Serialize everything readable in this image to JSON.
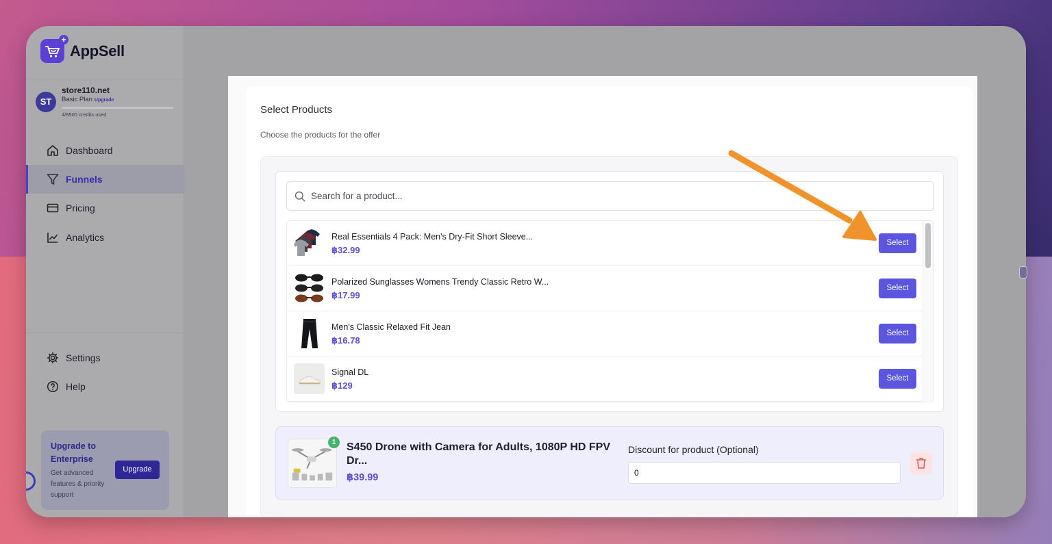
{
  "app": {
    "name": "AppSell"
  },
  "store": {
    "initials": "ST",
    "name": "store110.net",
    "plan": "Basic Plan",
    "upgrade_link": "Upgrade",
    "credits": "4/8500 credits used",
    "credits_fraction": 0.0005
  },
  "sidebar": {
    "items": [
      {
        "label": "Dashboard",
        "icon": "home-icon",
        "active": false
      },
      {
        "label": "Funnels",
        "icon": "filter-icon",
        "active": true
      },
      {
        "label": "Pricing",
        "icon": "credit-card-icon",
        "active": false
      },
      {
        "label": "Analytics",
        "icon": "line-chart-icon",
        "active": false
      }
    ],
    "bottom_items": [
      {
        "label": "Settings",
        "icon": "gear-icon"
      },
      {
        "label": "Help",
        "icon": "help-circle-icon"
      }
    ],
    "upgrade_card": {
      "title": "Upgrade to Enterprise",
      "description": "Get advanced features & priority support",
      "button": "Upgrade"
    }
  },
  "main": {
    "title": "Select Products",
    "subtitle": "Choose the products for the offer",
    "search": {
      "placeholder": "Search for a product...",
      "value": ""
    },
    "select_label": "Select",
    "products": [
      {
        "name": "Real Essentials 4 Pack: Men's Dry-Fit Short Sleeve...",
        "price": "฿32.99",
        "thumb": "tshirt-pack-image"
      },
      {
        "name": "Polarized Sunglasses Womens Trendy Classic Retro W...",
        "price": "฿17.99",
        "thumb": "sunglasses-image"
      },
      {
        "name": "Men's Classic Relaxed Fit Jean",
        "price": "฿16.78",
        "thumb": "jeans-image"
      },
      {
        "name": "Signal DL",
        "price": "฿129",
        "thumb": "sneaker-image"
      }
    ],
    "selected": {
      "count_badge": "1",
      "name": "S450 Drone with Camera for Adults, 1080P HD FPV Dr...",
      "price": "฿39.99",
      "discount_label": "Discount for product (Optional)",
      "discount_value": "0",
      "thumb": "drone-image"
    }
  },
  "colors": {
    "accent": "#5b55e0",
    "price": "#5b4fd6",
    "annotation_arrow": "#f0932b",
    "badge": "#45b46a"
  }
}
